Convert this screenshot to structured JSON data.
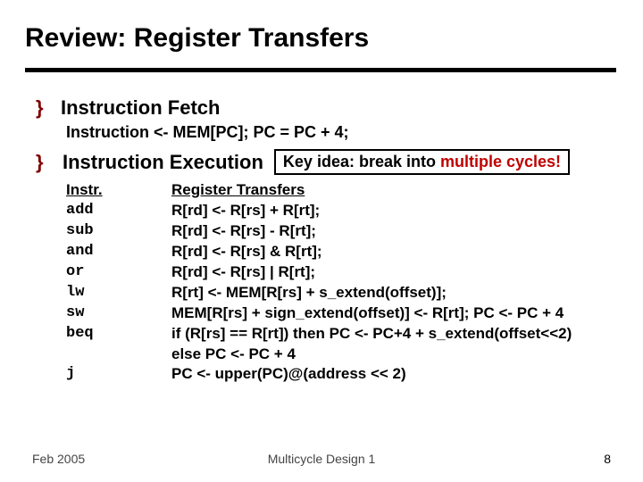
{
  "title": "Review: Register Transfers",
  "bullet1": "Instruction Fetch",
  "fetch_line": "Instruction <- MEM[PC];    PC = PC + 4;",
  "bullet2": "Instruction Execution",
  "callout_pre": "Key idea: break into ",
  "callout_hl": "multiple cycles!",
  "table": {
    "head_instr": "Instr.",
    "head_rt": "Register Transfers",
    "rows": [
      {
        "instr": "add",
        "rt": "R[rd] <- R[rs] + R[rt];"
      },
      {
        "instr": "sub",
        "rt": "R[rd] <- R[rs] - R[rt];"
      },
      {
        "instr": "and",
        "rt": "R[rd] <- R[rs] & R[rt];"
      },
      {
        "instr": "or",
        "rt": "R[rd] <- R[rs] | R[rt];"
      },
      {
        "instr": "lw",
        "rt": "R[rt] <- MEM[R[rs] + s_extend(offset)];"
      },
      {
        "instr": "sw",
        "rt": "MEM[R[rs] + sign_extend(offset)] <- R[rt]; PC <- PC + 4"
      },
      {
        "instr": "beq",
        "rt": "if (R[rs] == R[rt]) then PC <- PC+4 + s_extend(offset<<2)"
      },
      {
        "instr": "",
        "rt": "else PC <- PC + 4"
      },
      {
        "instr": "j",
        "rt": "PC <- upper(PC)@(address << 2)"
      }
    ]
  },
  "footer": {
    "left": "Feb 2005",
    "center": "Multicycle Design 1",
    "right": "8"
  }
}
